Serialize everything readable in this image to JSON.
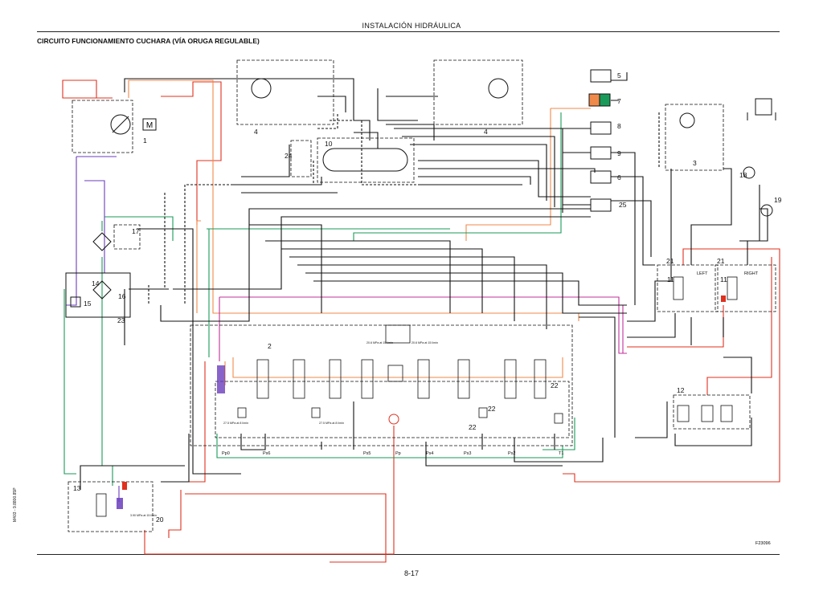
{
  "header": {
    "section": "INSTALACIÓN HIDRÁULICA"
  },
  "title": "CIRCUITO FUNCIONAMIENTO CUCHARA (VÍA ORUGA REGULABLE)",
  "footer": {
    "page": "8-17"
  },
  "side_code": "M403 - 9.8800.85P",
  "figure_code": "F23096",
  "components": {
    "c1": "1",
    "c2": "2",
    "c3": "3",
    "c4a": "4",
    "c4b": "4",
    "c5": "5",
    "c6": "6",
    "c7": "7",
    "c8": "8",
    "c9": "9",
    "c10": "10",
    "c11a": "11",
    "c11b": "11",
    "c12": "12",
    "c13": "13",
    "c14": "14",
    "c15": "15",
    "c16": "16",
    "c17": "17",
    "c18": "18",
    "c19": "19",
    "c20": "20",
    "c21a": "21",
    "c21b": "21",
    "c22a": "22",
    "c22b": "22",
    "c22c": "22",
    "c23": "23",
    "c24": "24",
    "c25": "25"
  },
  "labels": {
    "left": "LEFT",
    "right": "RIGHT",
    "motor": "M",
    "pp0": "Pp0",
    "ps6": "Ps6",
    "ps5": "Ps5",
    "pp": "Pp",
    "ps4": "Ps4",
    "ps3": "Ps3",
    "ps2": "Ps2",
    "t1": "T1",
    "pressure1": "27.5 MPa at 8 l/min",
    "pressure2": "27.5 MPa at 8 l/min",
    "pressure3": "20.6 MPa at 15 l/min",
    "pressure4": "20.6 MPa at 15 l/min",
    "pressure5": "3.90 MPa at 15 l/min"
  },
  "colors": {
    "pressure": "#e0301e",
    "pilot": "#f08a4b",
    "return": "#1a9a5a",
    "drain": "#6a3dbd",
    "signal": "#c0309a",
    "line": "#111111"
  }
}
